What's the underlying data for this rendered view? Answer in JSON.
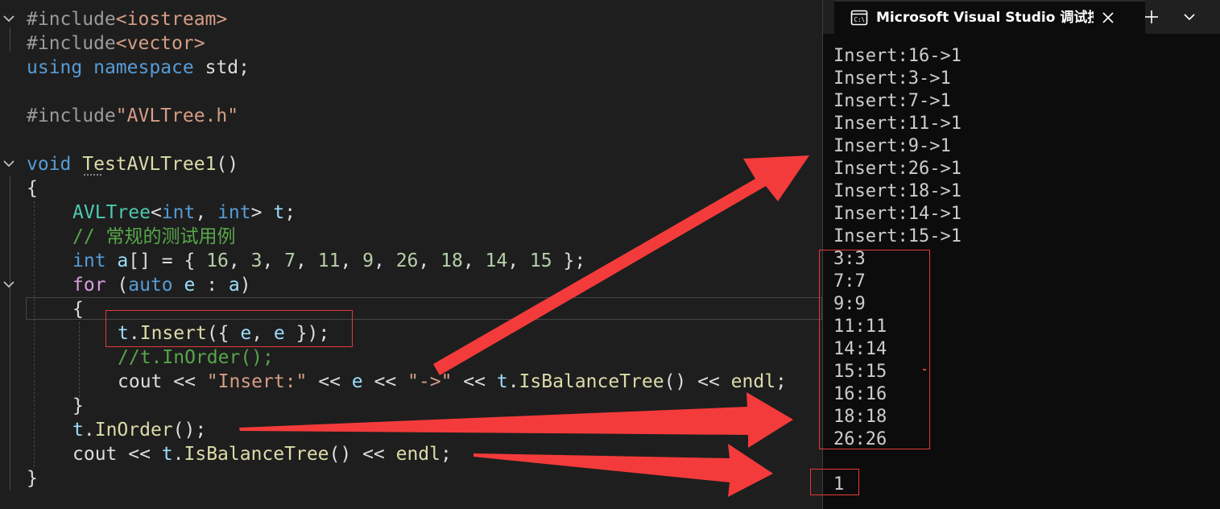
{
  "editor": {
    "lines": {
      "l1": {
        "kw": "#include",
        "s": "<iostream>"
      },
      "l2": {
        "kw": "#include",
        "s": "<vector>"
      },
      "l3": {
        "k1": "using",
        "k2": "namespace",
        "id": "std",
        "p": ";"
      },
      "l5": {
        "kw": "#include",
        "s": "\"AVLTree.h\""
      },
      "l7": {
        "k": "void",
        "fn": "TestAVLTree1",
        "p": "()"
      },
      "l8": {
        "p": "{"
      },
      "l9": {
        "t": "AVLTree",
        "a": "<",
        "k1": "int",
        "c": ",",
        "k2": "int",
        "b": ">",
        "v": "t",
        "p": ";"
      },
      "l10": {
        "c": "// 常规的测试用例"
      },
      "l11": {
        "k": "int",
        "v": "a",
        "p1": "[] = { ",
        "n1": "16",
        "n2": "3",
        "n3": "7",
        "n4": "11",
        "n5": "9",
        "n6": "26",
        "n7": "18",
        "n8": "14",
        "n9": "15",
        "p2": " };"
      },
      "l12": {
        "k": "for",
        "p1": " (",
        "k2": "auto",
        "v": "e",
        "p2": " : ",
        "v2": "a",
        "p3": ")"
      },
      "l13": {
        "p": "{"
      },
      "l14": {
        "v": "t",
        "d": ".",
        "fn": "Insert",
        "p1": "({ ",
        "v2": "e",
        "c": ", ",
        "v3": "e",
        "p2": " });"
      },
      "l15": {
        "c": "//t.InOrder();"
      },
      "l16": {
        "v": "cout",
        "o1": " << ",
        "s": "\"Insert:\"",
        "o2": " << ",
        "v2": "e",
        "o3": " << ",
        "s2": "\"->\"",
        "o4": " << ",
        "v3": "t",
        "d": ".",
        "fn": "IsBalanceTree",
        "p": "()",
        "o5": " << ",
        "v4": "endl",
        "sc": ";"
      },
      "l17": {
        "p": "}"
      },
      "l18": {
        "v": "t",
        "d": ".",
        "fn": "InOrder",
        "p": "();"
      },
      "l19": {
        "v": "cout",
        "o1": " << ",
        "v2": "t",
        "d": ".",
        "fn": "IsBalanceTree",
        "p": "()",
        "o2": " << ",
        "v3": "endl",
        "sc": ";"
      },
      "l20": {
        "p": "}"
      }
    }
  },
  "console": {
    "tab_title": "Microsoft Visual Studio 调试控",
    "output": [
      "Insert:16->1",
      "Insert:3->1",
      "Insert:7->1",
      "Insert:11->1",
      "Insert:9->1",
      "Insert:26->1",
      "Insert:18->1",
      "Insert:14->1",
      "Insert:15->1",
      "3:3",
      "7:7",
      "9:9",
      "11:11",
      "14:14",
      "15:15",
      "16:16",
      "18:18",
      "26:26",
      "",
      "1"
    ]
  },
  "colors": {
    "annotation": "#e53935",
    "keyword": "#569cd6",
    "comment": "#57a64a",
    "string": "#d69d85",
    "type": "#4ec9b0"
  }
}
